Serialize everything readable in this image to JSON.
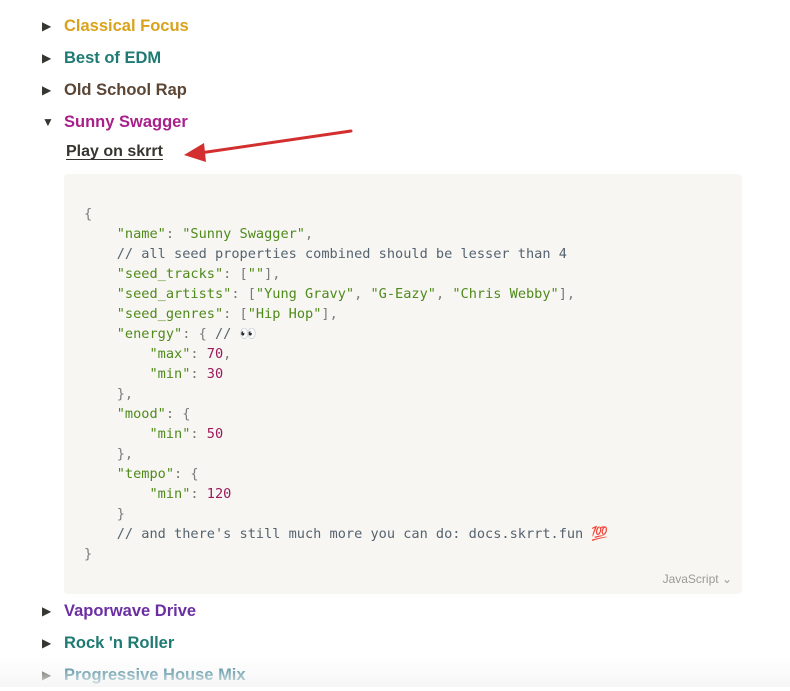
{
  "playlists_before": [
    {
      "label": "Classical Focus",
      "color": "#d9a21b",
      "expanded": false
    },
    {
      "label": "Best of EDM",
      "color": "#1f7a73",
      "expanded": false
    },
    {
      "label": "Old School Rap",
      "color": "#5b4636",
      "expanded": false
    },
    {
      "label": "Sunny Swagger",
      "color": "#a8208a",
      "expanded": true
    }
  ],
  "playlists_after": [
    {
      "label": "Vaporwave Drive",
      "color": "#6b2fa3",
      "expanded": false
    },
    {
      "label": "Rock 'n Roller",
      "color": "#1f7a73",
      "expanded": false
    },
    {
      "label": "Progressive House Mix",
      "color": "#1f6f86",
      "expanded": false
    }
  ],
  "icons": {
    "collapsed": "triangle-right-icon",
    "expanded": "triangle-down-icon",
    "annotation": "red-arrow-icon"
  },
  "expanded_section": {
    "play_link": "Play on skrrt",
    "code_language": "JavaScript",
    "code_lines": [
      [
        {
          "t": "{",
          "c": "pun"
        }
      ],
      [
        {
          "t": "    "
        },
        {
          "t": "\"name\"",
          "c": "str"
        },
        {
          "t": ": ",
          "c": "pun"
        },
        {
          "t": "\"Sunny Swagger\"",
          "c": "str"
        },
        {
          "t": ",",
          "c": "pun"
        }
      ],
      [
        {
          "t": "    "
        },
        {
          "t": "// all seed properties combined should be lesser than 4",
          "c": "com"
        }
      ],
      [
        {
          "t": "    "
        },
        {
          "t": "\"seed_tracks\"",
          "c": "str"
        },
        {
          "t": ": [",
          "c": "pun"
        },
        {
          "t": "\"\"",
          "c": "str"
        },
        {
          "t": "],",
          "c": "pun"
        }
      ],
      [
        {
          "t": "    "
        },
        {
          "t": "\"seed_artists\"",
          "c": "str"
        },
        {
          "t": ": [",
          "c": "pun"
        },
        {
          "t": "\"Yung Gravy\"",
          "c": "str"
        },
        {
          "t": ", ",
          "c": "pun"
        },
        {
          "t": "\"G-Eazy\"",
          "c": "str"
        },
        {
          "t": ", ",
          "c": "pun"
        },
        {
          "t": "\"Chris Webby\"",
          "c": "str"
        },
        {
          "t": "],",
          "c": "pun"
        }
      ],
      [
        {
          "t": "    "
        },
        {
          "t": "\"seed_genres\"",
          "c": "str"
        },
        {
          "t": ": [",
          "c": "pun"
        },
        {
          "t": "\"Hip Hop\"",
          "c": "str"
        },
        {
          "t": "],",
          "c": "pun"
        }
      ],
      [
        {
          "t": "    "
        },
        {
          "t": "\"energy\"",
          "c": "str"
        },
        {
          "t": ": { ",
          "c": "pun"
        },
        {
          "t": "// 👀",
          "c": "com"
        }
      ],
      [
        {
          "t": "        "
        },
        {
          "t": "\"max\"",
          "c": "str"
        },
        {
          "t": ": ",
          "c": "pun"
        },
        {
          "t": "70",
          "c": "num"
        },
        {
          "t": ",",
          "c": "pun"
        }
      ],
      [
        {
          "t": "        "
        },
        {
          "t": "\"min\"",
          "c": "str"
        },
        {
          "t": ": ",
          "c": "pun"
        },
        {
          "t": "30",
          "c": "num"
        }
      ],
      [
        {
          "t": "    "
        },
        {
          "t": "},",
          "c": "pun"
        }
      ],
      [
        {
          "t": "    "
        },
        {
          "t": "\"mood\"",
          "c": "str"
        },
        {
          "t": ": {",
          "c": "pun"
        }
      ],
      [
        {
          "t": "        "
        },
        {
          "t": "\"min\"",
          "c": "str"
        },
        {
          "t": ": ",
          "c": "pun"
        },
        {
          "t": "50",
          "c": "num"
        }
      ],
      [
        {
          "t": "    "
        },
        {
          "t": "},",
          "c": "pun"
        }
      ],
      [
        {
          "t": "    "
        },
        {
          "t": "\"tempo\"",
          "c": "str"
        },
        {
          "t": ": {",
          "c": "pun"
        }
      ],
      [
        {
          "t": "        "
        },
        {
          "t": "\"min\"",
          "c": "str"
        },
        {
          "t": ": ",
          "c": "pun"
        },
        {
          "t": "120",
          "c": "num"
        }
      ],
      [
        {
          "t": "    "
        },
        {
          "t": "}",
          "c": "pun"
        }
      ],
      [
        {
          "t": "    "
        },
        {
          "t": "// and there's still much more you can do: docs.skrrt.fun 💯",
          "c": "com"
        }
      ],
      [
        {
          "t": "}",
          "c": "pun"
        }
      ]
    ]
  }
}
